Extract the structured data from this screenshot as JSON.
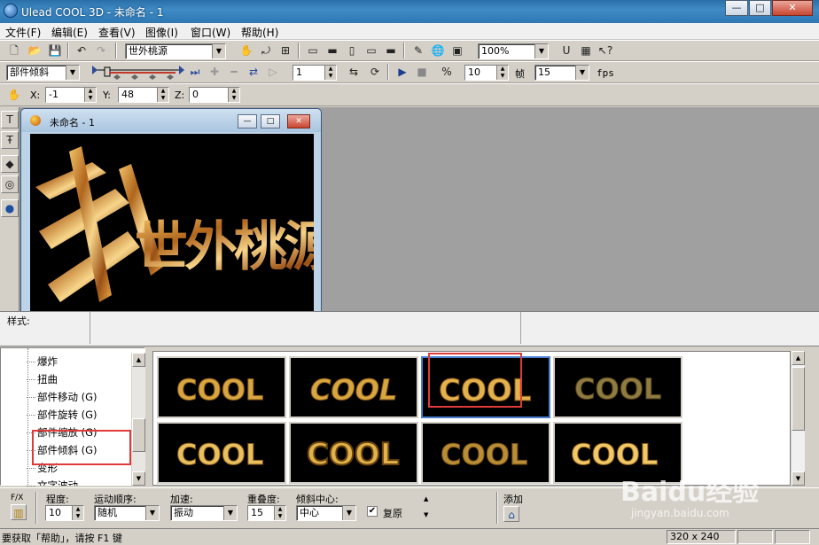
{
  "window": {
    "title": "Ulead COOL 3D - 未命名 - 1"
  },
  "menu": [
    "文件(F)",
    "编辑(E)",
    "查看(V)",
    "图像(I)",
    "窗口(W)",
    "帮助(H)"
  ],
  "toolbar1": {
    "text_value": "世外桃源",
    "zoom": "100%"
  },
  "toolbar2": {
    "effect": "部件倾斜",
    "frame": "1",
    "frames": "10",
    "frame_label": "帧",
    "fps_value": "15",
    "fps_label": "fps"
  },
  "toolbar3": {
    "x_label": "X:",
    "x": "-1",
    "y_label": "Y:",
    "y": "48",
    "z_label": "Z:",
    "z": "0"
  },
  "document": {
    "title": "未命名 - 1",
    "text": "世外桃源"
  },
  "style_panel": {
    "label": "样式:"
  },
  "tree": {
    "items": [
      "爆炸",
      "扭曲",
      "部件移动 (G)",
      "部件旋转 (G)",
      "部件缩放 (G)",
      "部件倾斜 (G)",
      "变形",
      "文字波动"
    ]
  },
  "gallery": {
    "thumbnails": [
      "COOL",
      "COOL",
      "COOL",
      "COOL",
      "COOL",
      "COOL",
      "COOL",
      "COOL"
    ]
  },
  "params": {
    "fx_label": "F/X",
    "degree_label": "程度:",
    "degree": "10",
    "order_label": "运动顺序:",
    "order": "随机",
    "accel_label": "加速:",
    "accel": "振动",
    "overlap_label": "重叠度:",
    "overlap": "15",
    "center_label": "倾斜中心:",
    "center": "中心",
    "restore_label": "复原",
    "add_label": "添加"
  },
  "status": {
    "help": "要获取「帮助」，请按 F1 键",
    "size": "320 x 240"
  },
  "watermark": {
    "brand": "Baidu经验",
    "url": "jingyan.baidu.com"
  },
  "colors": {
    "highlight": "#e03a3a",
    "gold": "#d8a640",
    "titlebar": "#2f78b4"
  }
}
